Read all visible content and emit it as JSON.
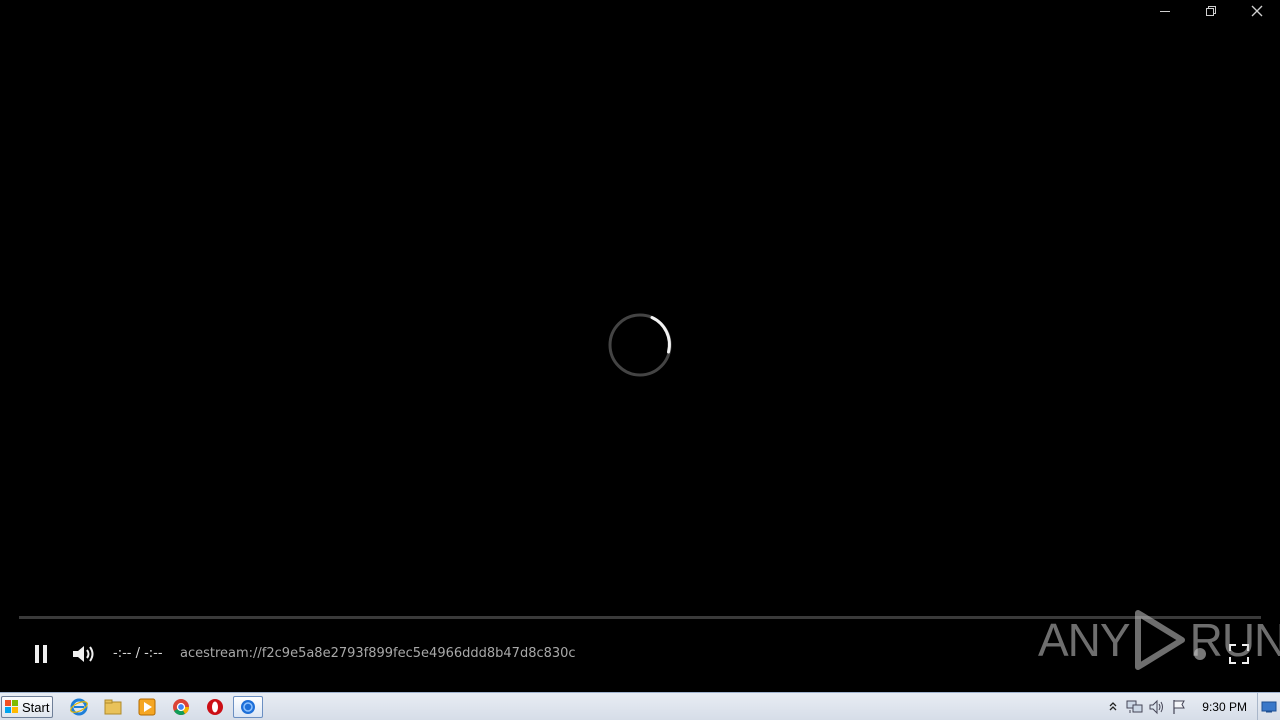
{
  "window": {
    "minimize_label": "minimize",
    "restore_label": "restore",
    "close_label": "close"
  },
  "player": {
    "time_display": "-:-- / -:--",
    "stream_url": "acestream://f2c9e5a8e2793f899fec5e4966ddd8b47d8c830c",
    "progress_fraction": 0,
    "state": "loading"
  },
  "watermark": {
    "text_left": "ANY",
    "text_right": "RUN"
  },
  "taskbar": {
    "start_label": "Start",
    "apps": [
      {
        "icon": "internet-explorer-icon"
      },
      {
        "icon": "file-explorer-icon"
      },
      {
        "icon": "media-player-icon"
      },
      {
        "icon": "chrome-icon"
      },
      {
        "icon": "opera-icon"
      },
      {
        "icon": "acestream-icon",
        "active": true
      }
    ],
    "clock": "9:30 PM"
  },
  "colors": {
    "background": "#000000",
    "taskbar": "#dfe5ee",
    "progress_track": "#3a3a3a",
    "accent_blue": "#1e6fd8"
  }
}
